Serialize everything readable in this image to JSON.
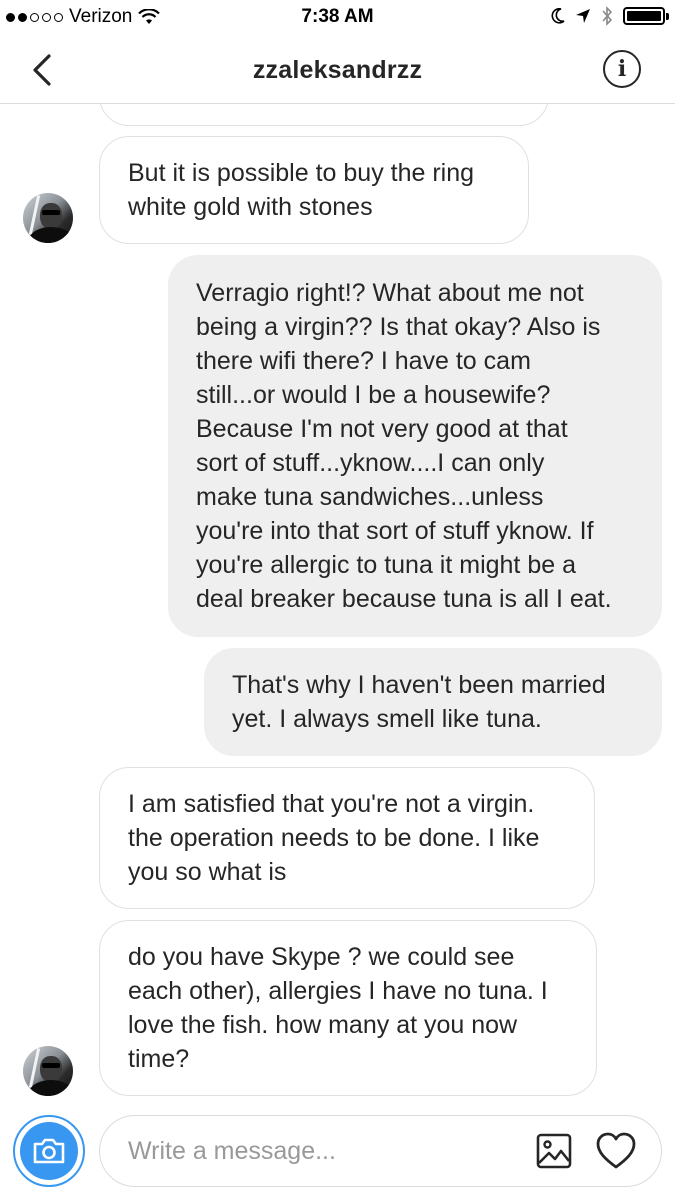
{
  "status_bar": {
    "carrier": "Verizon",
    "time": "7:38 AM"
  },
  "header": {
    "title": "zzaleksandrzz",
    "info_glyph": "i"
  },
  "messages": [
    {
      "from": "them",
      "text": ""
    },
    {
      "from": "them",
      "lines": [
        "But it is possible to buy the ring",
        "white gold with stones"
      ]
    },
    {
      "from": "me",
      "lines": [
        "Verragio right!? What about me not",
        "being a virgin?? Is that okay? Also is",
        "there wifi there? I have to cam",
        "still...or would I be a housewife?",
        "Because I'm not very good at that",
        "sort of stuff...yknow....I can only",
        "make tuna sandwiches...unless",
        "you're into that sort of stuff yknow. If",
        "you're allergic to tuna it might be a",
        "deal breaker because tuna is all I eat."
      ]
    },
    {
      "from": "me",
      "lines": [
        "That's why I haven't been married",
        "yet. I always smell like tuna."
      ]
    },
    {
      "from": "them",
      "lines": [
        "I am satisfied that you're not a virgin.",
        "the operation needs to be done. I like",
        "you so what is"
      ]
    },
    {
      "from": "them",
      "lines": [
        "do you have Skype ? we could see",
        "each other), allergies I have no tuna. I",
        "love the fish. how many at you now",
        "time?"
      ]
    }
  ],
  "composer": {
    "placeholder": "Write a message...",
    "value": ""
  },
  "icons": {
    "back": "chevron-left-icon",
    "info": "info-icon",
    "camera": "camera-icon",
    "gallery": "image-icon",
    "heart": "heart-icon"
  },
  "colors": {
    "accent": "#3897f0",
    "bubble_out": "#efefef",
    "bubble_in_border": "#e0e0e0"
  }
}
